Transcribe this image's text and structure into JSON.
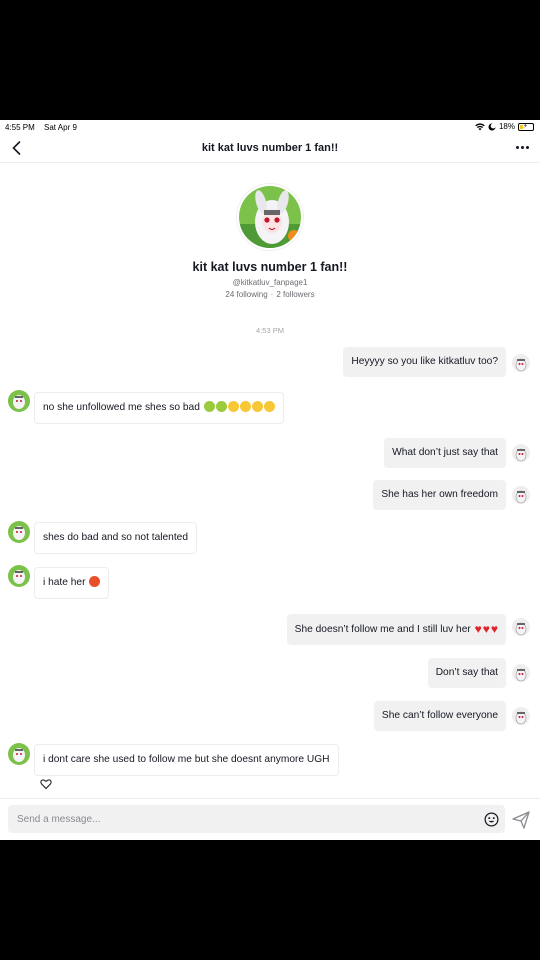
{
  "status_bar": {
    "time": "4:55 PM",
    "date": "Sat Apr 9",
    "battery": "18%",
    "battery_level": 0.18
  },
  "header": {
    "title": "kit kat luvs number 1 fan!!"
  },
  "profile": {
    "name": "kit kat luvs number 1 fan!!",
    "handle": "@kitkatluv_fanpage1",
    "following": "24 following",
    "followers": "2 followers"
  },
  "timestamp": "4:53 PM",
  "messages": [
    {
      "dir": "out",
      "text": "Heyyyy so you like kitkatluv too?"
    },
    {
      "dir": "in",
      "text": "no she unfollowed me shes so bad"
    },
    {
      "dir": "out",
      "text": "What don’t just say that"
    },
    {
      "dir": "out",
      "text": "She has her own freedom"
    },
    {
      "dir": "in",
      "text": "shes do bad and so not talented"
    },
    {
      "dir": "in",
      "text": "i hate her"
    },
    {
      "dir": "out",
      "text": "She doesn’t follow me and I still luv her"
    },
    {
      "dir": "out",
      "text": "Don’t say that"
    },
    {
      "dir": "out",
      "text": "She can’t follow everyone"
    },
    {
      "dir": "in",
      "text": "i dont care she used to follow me but she doesnt anymore UGH"
    }
  ],
  "input": {
    "placeholder": "Send a message..."
  },
  "icons": {
    "back": "chevron-left-icon",
    "more": "more-horizontal-icon",
    "emoji": "emoji-icon",
    "send": "send-icon",
    "like": "heart-outline-icon"
  },
  "colors": {
    "bubble_out": "#f1f1f2",
    "heart_red": "#e0222a",
    "text": "#161823"
  }
}
